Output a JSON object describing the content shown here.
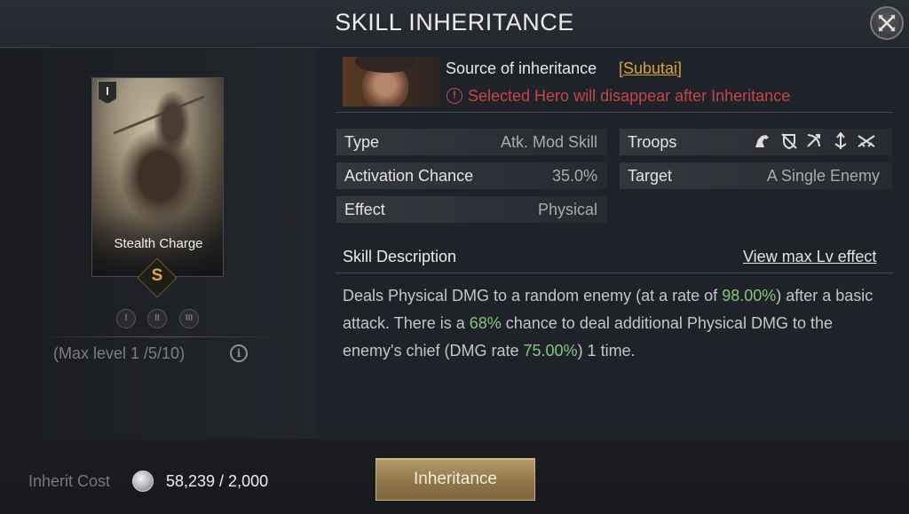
{
  "header": {
    "title": "SKILL INHERITANCE"
  },
  "skill_card": {
    "tier_badge": "I",
    "name": "Stealth Charge",
    "grade": "S",
    "level_icons": [
      "I",
      "II",
      "III"
    ],
    "max_level": "(Max level  1 /5/10)"
  },
  "source": {
    "label": "Source of inheritance",
    "hero_name": "[Subutai]",
    "warning": "Selected Hero will disappear after Inheritance"
  },
  "stats": {
    "type": {
      "label": "Type",
      "value": "Atk. Mod Skill"
    },
    "activation": {
      "label": "Activation Chance",
      "value": "35.0%"
    },
    "effect": {
      "label": "Effect",
      "value": "Physical"
    },
    "troops": {
      "label": "Troops",
      "icons": [
        "cavalry-icon",
        "shield-icon",
        "archer-icon",
        "spear-icon",
        "siege-icon"
      ]
    },
    "target": {
      "label": "Target",
      "value": "A Single Enemy"
    }
  },
  "description": {
    "title": "Skill Description",
    "max_link": "View max Lv effect",
    "parts": [
      "Deals Physical DMG to a random enemy (at a rate of ",
      "98.00%",
      ") after a basic attack. There is a ",
      "68%",
      " chance to deal additional Physical DMG to the enemy's chief (DMG rate ",
      "75.00%",
      ") 1 time."
    ]
  },
  "footer": {
    "cost_label": "Inherit Cost",
    "cost_value": "58,239 / 2,000",
    "button_label": "Inheritance"
  },
  "colors": {
    "highlight": "#84c77a",
    "warning": "#c44747",
    "link_gold": "#d9a23a"
  }
}
